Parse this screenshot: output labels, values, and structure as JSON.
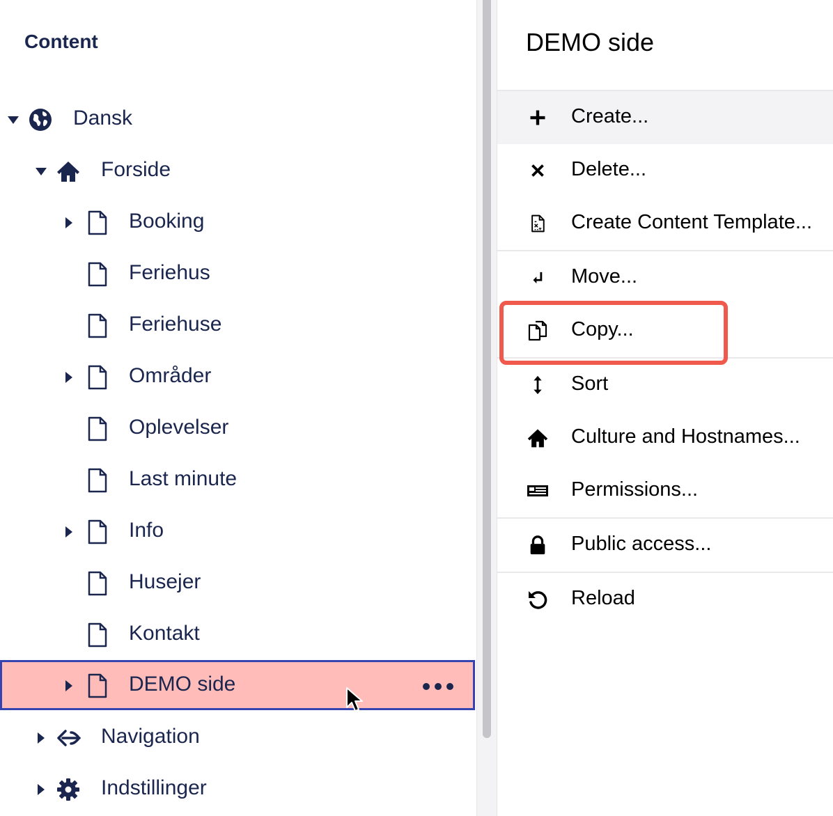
{
  "tree": {
    "heading": "Content",
    "nodes": [
      {
        "label": "Dansk",
        "icon": "globe-icon",
        "caret": "down"
      },
      {
        "label": "Forside",
        "icon": "home-icon",
        "caret": "down"
      },
      {
        "label": "Booking",
        "icon": "document-icon",
        "caret": "right"
      },
      {
        "label": "Feriehus",
        "icon": "document-icon",
        "caret": "none"
      },
      {
        "label": "Feriehuse",
        "icon": "document-icon",
        "caret": "none"
      },
      {
        "label": "Områder",
        "icon": "document-icon",
        "caret": "right"
      },
      {
        "label": "Oplevelser",
        "icon": "document-icon",
        "caret": "none"
      },
      {
        "label": "Last minute",
        "icon": "document-icon",
        "caret": "none"
      },
      {
        "label": "Info",
        "icon": "document-icon",
        "caret": "right"
      },
      {
        "label": "Husejer",
        "icon": "document-icon",
        "caret": "none"
      },
      {
        "label": "Kontakt",
        "icon": "document-icon",
        "caret": "none"
      },
      {
        "label": "DEMO side",
        "icon": "document-icon",
        "caret": "right",
        "selected": true
      },
      {
        "label": "Navigation",
        "icon": "navigation-icon",
        "caret": "right"
      },
      {
        "label": "Indstillinger",
        "icon": "gear-icon",
        "caret": "right"
      }
    ]
  },
  "menu": {
    "title": "DEMO side",
    "items": [
      {
        "label": "Create...",
        "icon": "plus-icon"
      },
      {
        "label": "Delete...",
        "icon": "close-icon"
      },
      {
        "label": "Create Content Template...",
        "icon": "template-icon"
      },
      {
        "label": "Move...",
        "icon": "move-icon"
      },
      {
        "label": "Copy...",
        "icon": "copy-icon"
      },
      {
        "label": "Sort",
        "icon": "sort-icon"
      },
      {
        "label": "Culture and Hostnames...",
        "icon": "home-icon"
      },
      {
        "label": "Permissions...",
        "icon": "permissions-icon"
      },
      {
        "label": "Public access...",
        "icon": "lock-icon"
      },
      {
        "label": "Reload",
        "icon": "reload-icon"
      }
    ]
  },
  "colors": {
    "tree_text": "#1b264f",
    "selected_bg": "#ffbcb9",
    "selected_border": "#3544b1",
    "highlight": "#f05a4d",
    "hover_bg": "#f3f3f5"
  }
}
